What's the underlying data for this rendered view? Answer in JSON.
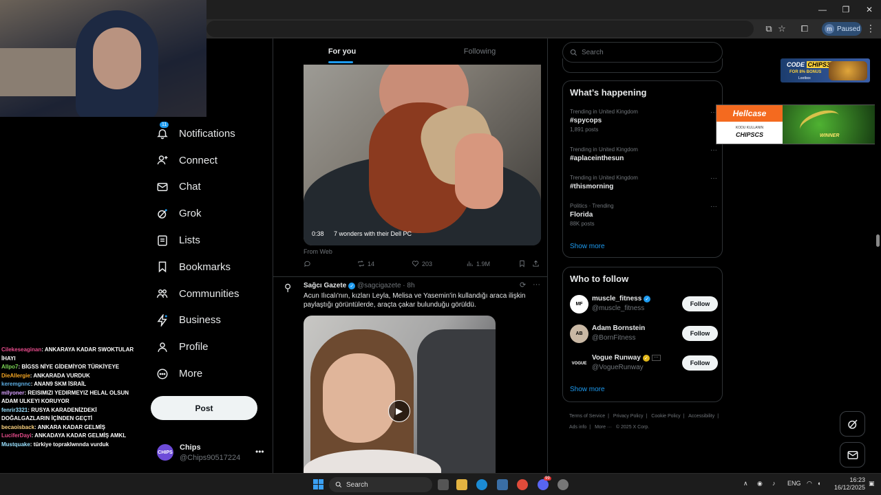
{
  "browser": {
    "profile_initial": "m",
    "profile_status": "Paused",
    "window_controls": [
      "—",
      "❐",
      "✕"
    ]
  },
  "chat": [
    {
      "user": "Cilekeseaginan",
      "msg": ": ANKARAYA KADAR SWOKTULAR İHAYI"
    },
    {
      "user": "Allpo7",
      "msg": ": BİGSS NİYE GİDEMİYOR TÜRKİYEYE"
    },
    {
      "user": "DieAllergie",
      "msg": ": ANKARADA VURDUK"
    },
    {
      "user": "keremgnnc",
      "msg": ": ANAN9 SKM İSRAİL"
    },
    {
      "user": "mllyoner",
      "msg": ": REISIMIZI YEDIRMEYIZ HELAL OLSUN ADAM ULKEYI KORUYOR"
    },
    {
      "user": "fenrir3321",
      "msg": ": RUSYA KARADENİZDEKİ DOĞALGAZLARIN İÇİNDEN GEÇTİ"
    },
    {
      "user": "becaoisback",
      "msg": ": ANKARA KADAR GELMİŞ"
    },
    {
      "user": "LuciferDayi",
      "msg": ": ANKADAYA KADAR GELMİŞ AMKL"
    },
    {
      "user": "Mustquake",
      "msg": ": türkiye topraklwnnda vurduk"
    }
  ],
  "nav": {
    "notifications_badge": "11",
    "items": [
      {
        "label": "Notifications",
        "icon": "bell-icon"
      },
      {
        "label": "Connect",
        "icon": "person-plus-icon"
      },
      {
        "label": "Chat",
        "icon": "envelope-icon"
      },
      {
        "label": "Grok",
        "icon": "grok-icon"
      },
      {
        "label": "Lists",
        "icon": "list-icon"
      },
      {
        "label": "Bookmarks",
        "icon": "bookmark-icon"
      },
      {
        "label": "Communities",
        "icon": "people-icon"
      },
      {
        "label": "Business",
        "icon": "lightning-icon"
      },
      {
        "label": "Profile",
        "icon": "person-icon"
      },
      {
        "label": "More",
        "icon": "more-circle-icon"
      }
    ],
    "post_label": "Post"
  },
  "account": {
    "name": "Chips",
    "handle": "@Chips90517224",
    "avatar_text": "CHIPS"
  },
  "feed": {
    "tabs": [
      "For you",
      "Following"
    ],
    "tweet1": {
      "video_duration": "0:38",
      "video_title": "7 wonders with their Dell PC",
      "source": "From Web",
      "retweets": "14",
      "likes": "203",
      "views": "1.9M"
    },
    "tweet2": {
      "name": "Sağcı Gazete",
      "handle": "@sagcigazete · 8h",
      "text": "Acun Ilıcalı'nın, kızları Leyla, Melisa ve Yasemin'in kullandığı araca ilişkin paylaştığı görüntülerde, araçta çakar bulunduğu görüldü."
    }
  },
  "right": {
    "search_placeholder": "Search",
    "happening_title": "What’s happening",
    "trends": [
      {
        "context": "Trending in United Kingdom",
        "tag": "#spycops",
        "count": "1,891 posts"
      },
      {
        "context": "Trending in United Kingdom",
        "tag": "#aplaceinthesun",
        "count": ""
      },
      {
        "context": "Trending in United Kingdom",
        "tag": "#thismorning",
        "count": ""
      },
      {
        "context": "Politics · Trending",
        "tag": "Florida",
        "count": "88K posts"
      }
    ],
    "show_more": "Show more",
    "who_to_follow_title": "Who to follow",
    "follow": [
      {
        "name": "muscle_fitness",
        "handle": "@muscle_fitness",
        "avatar": "MF"
      },
      {
        "name": "Adam Bornstein",
        "handle": "@BornFitness",
        "avatar": "AB"
      },
      {
        "name": "Vogue Runway",
        "handle": "@VogueRunway",
        "avatar": "VOGUE"
      }
    ],
    "follow_label": "Follow",
    "footer": [
      "Terms of Service",
      "|",
      "Privacy Policy",
      "|",
      "Cookie Policy",
      "|",
      "Accessibility",
      "|",
      "Ads info",
      "|",
      "More ···",
      "© 2025 X Corp."
    ]
  },
  "ads": {
    "ad1_code_prefix": "CODE",
    "ad1_code": "CHIPS31",
    "ad1_bonus": "FOR 8% BONUS",
    "ad1_brand": "Lootbox",
    "ad2_brand": "Hellcase",
    "ad2_kodu": "KODU KULLANIN",
    "ad2_code": "CHIPSCS",
    "ad2_winner": "WINNER"
  },
  "taskbar": {
    "search": "Search",
    "lang": "ENG",
    "time": "16:23",
    "date": "16/12/2025",
    "discord_badge": "99"
  }
}
